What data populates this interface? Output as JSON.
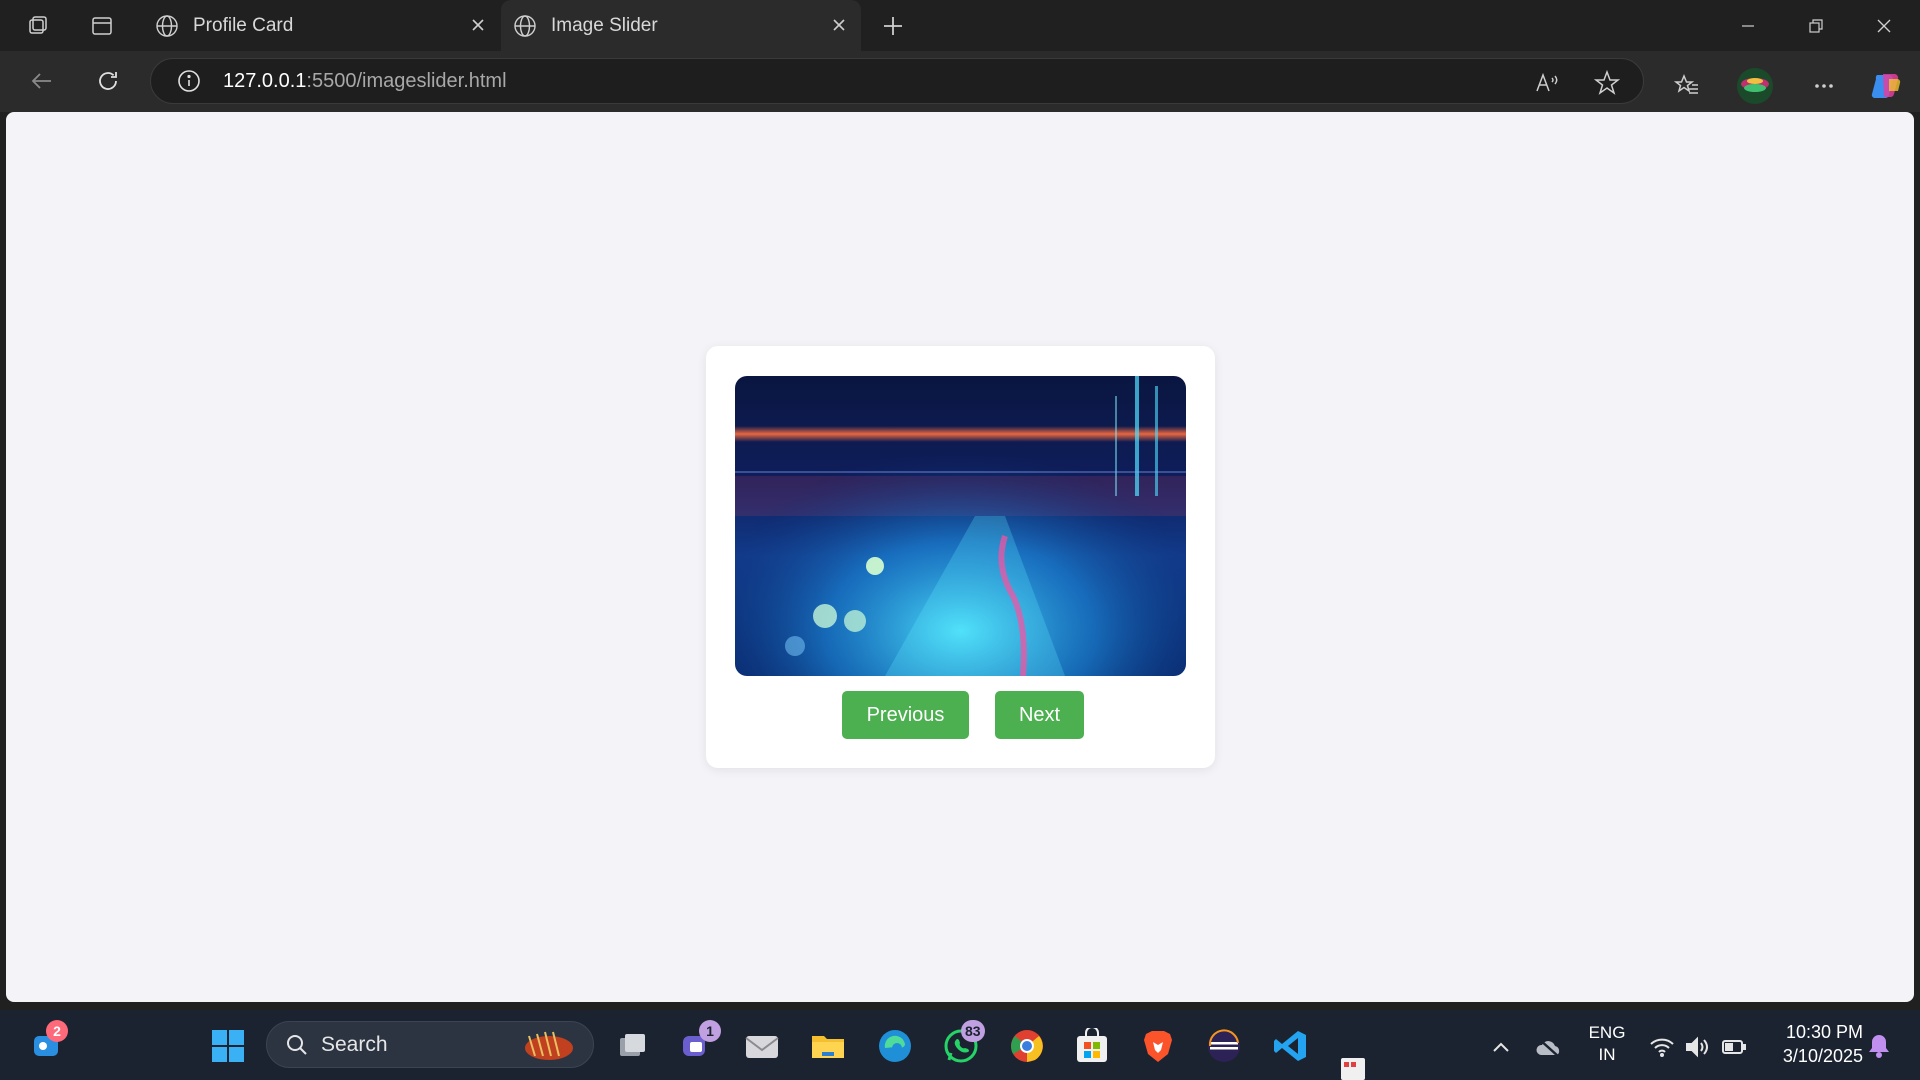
{
  "browser": {
    "tabs": [
      {
        "title": "Profile Card",
        "active": false
      },
      {
        "title": "Image Slider",
        "active": true
      }
    ],
    "address": {
      "host": "127.0.0.1",
      "path": ":5500/imageslider.html"
    }
  },
  "page": {
    "slider": {
      "image_description": "Abstract digital data visualization with blue and red glowing lights",
      "prev_label": "Previous",
      "next_label": "Next"
    }
  },
  "taskbar": {
    "search_label": "Search",
    "badges": {
      "chat": "2",
      "teams": "1",
      "whatsapp": "83"
    },
    "language": {
      "line1": "ENG",
      "line2": "IN"
    },
    "clock": {
      "time": "10:30 PM",
      "date": "3/10/2025"
    }
  },
  "colors": {
    "button": "#4caf50",
    "page_bg": "#f4f4f8",
    "card_bg": "#ffffff"
  }
}
